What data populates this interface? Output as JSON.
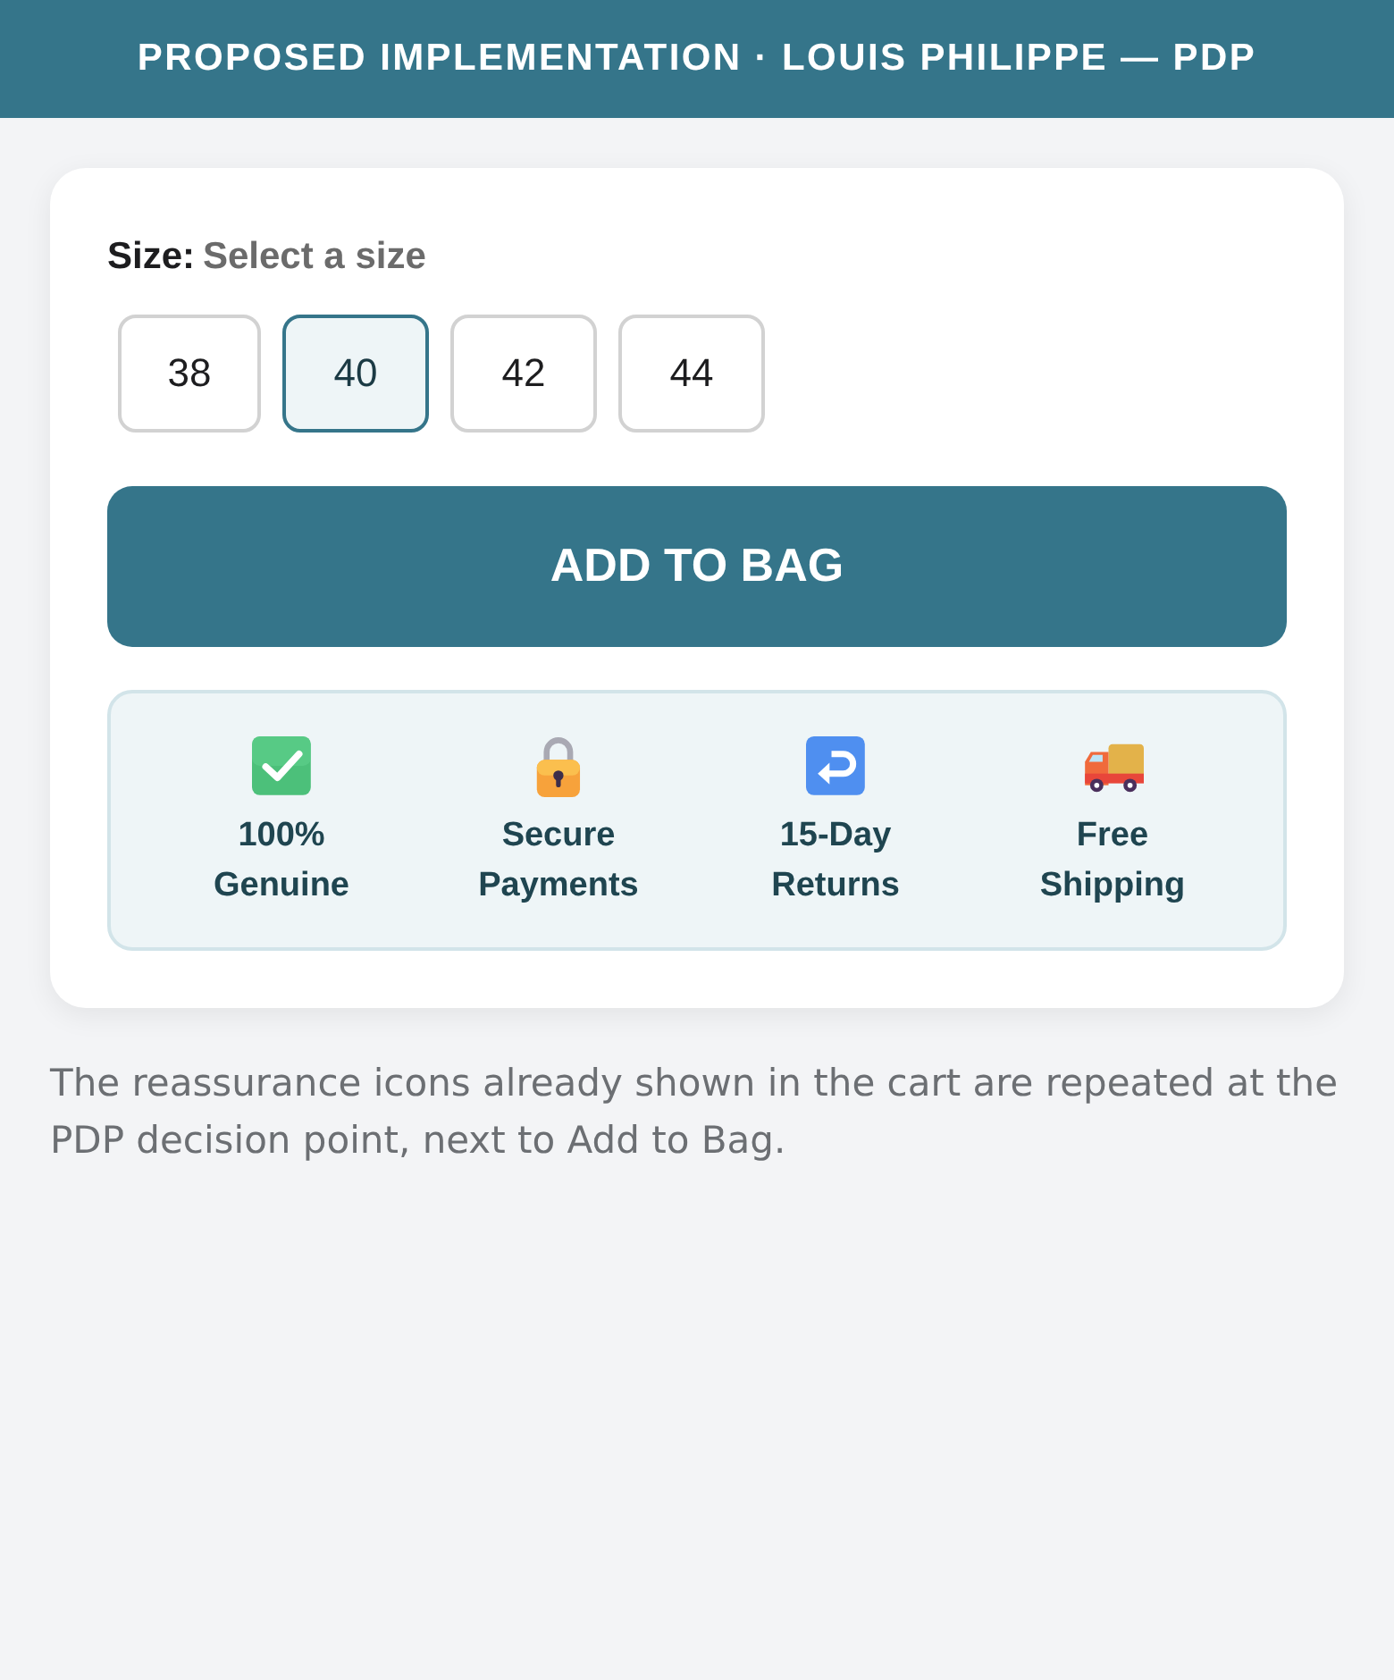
{
  "header": {
    "title": "PROPOSED IMPLEMENTATION · LOUIS PHILIPPE — PDP"
  },
  "size_picker": {
    "label": "Size:",
    "hint": "Select a size",
    "sizes": [
      {
        "label": "38",
        "selected": false
      },
      {
        "label": "40",
        "selected": true
      },
      {
        "label": "42",
        "selected": false
      },
      {
        "label": "44",
        "selected": false
      }
    ]
  },
  "add_button": {
    "label": "ADD TO BAG"
  },
  "reassurance": [
    {
      "lines": [
        "100%",
        "Genuine"
      ]
    },
    {
      "lines": [
        "Secure",
        "Payments"
      ]
    },
    {
      "lines": [
        "15-Day",
        "Returns"
      ]
    },
    {
      "lines": [
        "Free",
        "Shipping"
      ]
    }
  ],
  "note": "The reassurance icons already shown in the cart are repeated at the PDP decision point, next to Add to Bag."
}
